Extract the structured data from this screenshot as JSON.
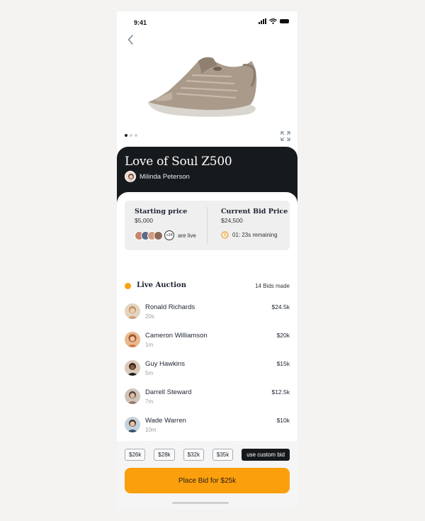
{
  "status": {
    "time": "9:41"
  },
  "product": {
    "title": "Love of Soul Z500",
    "seller": "Milinda Peterson",
    "carousel_count": 3,
    "carousel_active": 1
  },
  "bid_summary": {
    "starting_label": "Starting price",
    "starting_value": "$5,000",
    "live_more": "+24",
    "live_text": "are live",
    "current_label": "Current Bid Price",
    "current_value": "$24,500",
    "remaining": "01: 23s remaining"
  },
  "auction": {
    "title": "Live Auction",
    "bids_made": "14 Bids made",
    "bids": [
      {
        "name": "Ronald Richards",
        "ago": "20s",
        "amount": "$24.5k"
      },
      {
        "name": "Cameron Williamson",
        "ago": "1m",
        "amount": "$20k"
      },
      {
        "name": "Guy Hawkins",
        "ago": "5m",
        "amount": "$15k"
      },
      {
        "name": "Darrell Steward",
        "ago": "7m",
        "amount": "$12.5k"
      },
      {
        "name": "Wade Warren",
        "ago": "10m",
        "amount": "$10k"
      }
    ]
  },
  "quick_bids": [
    "$26k",
    "$28k",
    "$32k",
    "$35k"
  ],
  "custom_bid_label": "use custom bid",
  "place_bid_label": "Place Bid for $25k",
  "colors": {
    "accent": "#fb9f0d",
    "dark": "#161a1d",
    "live_dot": "#f8a20f"
  },
  "icons": [
    "back-chevron-icon",
    "expand-icon",
    "clock-icon",
    "signal-icon",
    "wifi-icon",
    "battery-icon"
  ]
}
